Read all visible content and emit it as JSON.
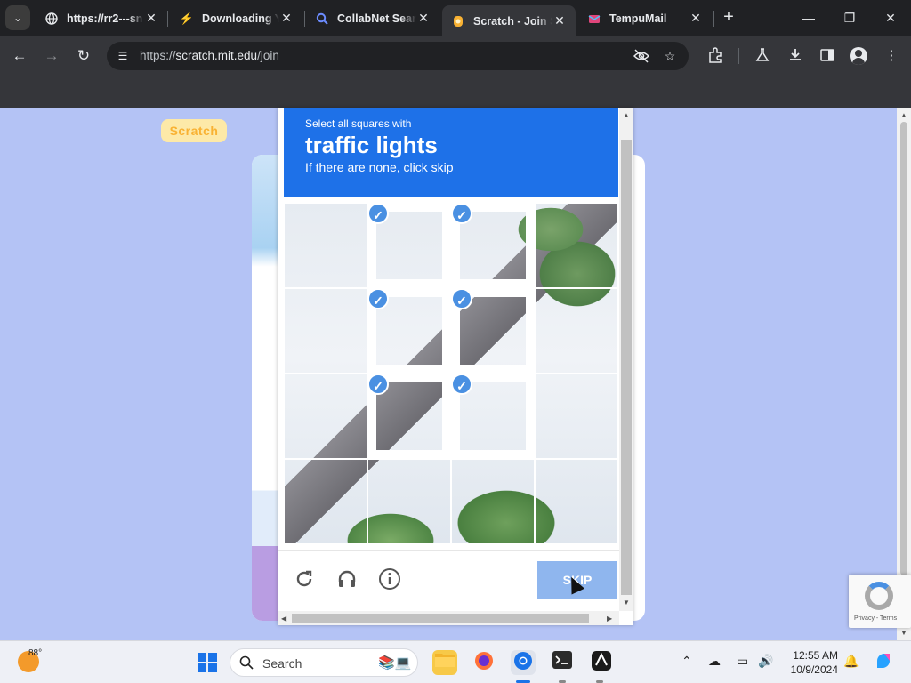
{
  "browser": {
    "tabs": [
      {
        "title": "https://rr2---sn",
        "favicon": "globe-icon",
        "active": false
      },
      {
        "title": "Downloading Y",
        "favicon": "download-bolt-icon",
        "active": false
      },
      {
        "title": "CollabNet Sear",
        "favicon": "search-icon",
        "active": false
      },
      {
        "title": "Scratch - Join S",
        "favicon": "scratch-cat-icon",
        "active": true
      },
      {
        "title": "TempuMail",
        "favicon": "mail-icon",
        "active": false
      }
    ],
    "url": {
      "scheme": "https://",
      "host": "scratch.mit.edu",
      "path": "/join"
    }
  },
  "page": {
    "logo_text": "Scratch"
  },
  "captcha": {
    "instruction_line1": "Select all squares with",
    "target": "traffic lights",
    "instruction_line3": "If there are none, click skip",
    "selected_cells": [
      1,
      2,
      5,
      6,
      9,
      10
    ],
    "skip_label": "SKIP"
  },
  "recaptcha": {
    "footer": "Privacy - Terms"
  },
  "taskbar": {
    "temperature": "88°",
    "search_placeholder": "Search",
    "time": "12:55 AM",
    "date": "10/9/2024"
  },
  "colors": {
    "captcha_header": "#1e71e8",
    "page_background": "#b4c3f5",
    "skip_button": "#8fb6ee"
  }
}
